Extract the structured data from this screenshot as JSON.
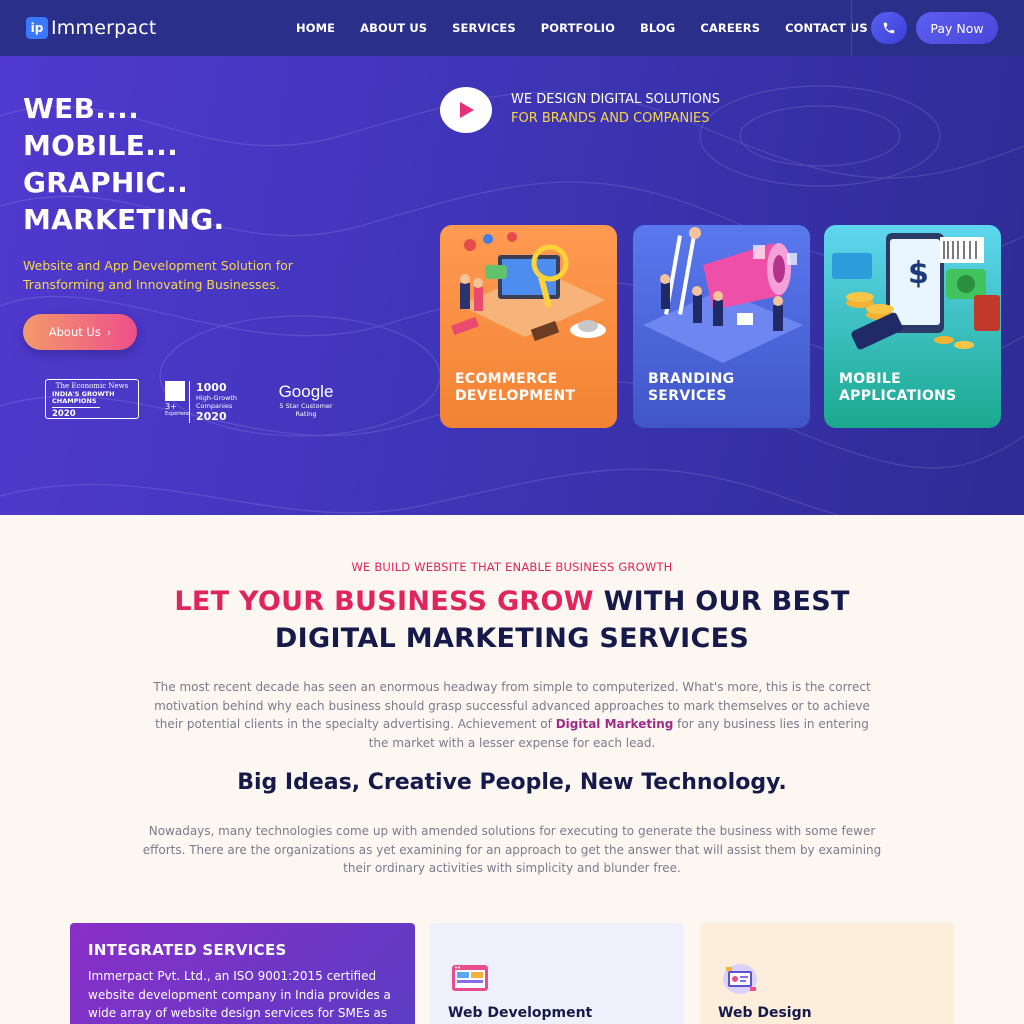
{
  "brand": {
    "logo_mark": "ip",
    "name": "Immerpact"
  },
  "nav": {
    "items": [
      "HOME",
      "ABOUT US",
      "SERVICES",
      "PORTFOLIO",
      "BLOG",
      "CAREERS",
      "CONTACT US"
    ],
    "pay_label": "Pay Now"
  },
  "hero": {
    "headline": [
      "WEB....",
      "MOBILE...",
      "GRAPHIC..",
      "MARKETING."
    ],
    "subtitle": "Website and App Development Solution for Transforming and Innovating Businesses.",
    "about_button": "About Us",
    "tagline_1": "WE DESIGN DIGITAL SOLUTIONS",
    "tagline_2": "FOR BRANDS AND COMPANIES",
    "badges": {
      "et_source": "The Economic News",
      "et_title": "INDIA'S GROWTH CHAMPIONS",
      "et_year": "2020",
      "hg_years": "3+",
      "hg_exp": "Experienc",
      "hg_count": "1000",
      "hg_text": "High-Growth Companies",
      "hg_year": "2020",
      "google_name": "Google",
      "google_sub": "5 Star Customer Rating"
    },
    "cards": [
      {
        "line1": "ECOMMERCE",
        "line2": "DEVELOPMENT"
      },
      {
        "line1": "BRANDING",
        "line2": "SERVICES"
      },
      {
        "line1": "MOBILE",
        "line2": "APPLICATIONS"
      }
    ]
  },
  "content": {
    "eyebrow": "WE BUILD WEBSITE THAT ENABLE BUSINESS GROWTH",
    "title_pink": "LET YOUR BUSINESS GROW",
    "title_rest": "WITH OUR BEST",
    "title_line2": "DIGITAL MARKETING SERVICES",
    "para1_a": "The most recent decade has seen an enormous headway from simple to computerized. What's more, this is the correct motivation behind why each business should grasp successful advanced approaches to mark themselves or to achieve their potential clients in the specialty advertising. Achievement of ",
    "para1_hl": "Digital Marketing",
    "para1_b": " for any business lies in entering the market with a lesser expense for each lead.",
    "subtitle": "Big Ideas, Creative People, New Technology.",
    "para2": "Nowadays, many technologies come up with amended solutions for executing to generate the business with some fewer efforts. There are the organizations as yet examining for an approach to get the answer that will assist them by examining their ordinary activities with simplicity and blunder free."
  },
  "services": {
    "integrated_title": "INTEGRATED SERVICES",
    "integrated_text": "Immerpact Pvt. Ltd., an ISO 9001:2015 certified website development company in India provides a wide array of website design services for SMEs as",
    "web_dev": "Web Development",
    "web_design": "Web Design"
  }
}
